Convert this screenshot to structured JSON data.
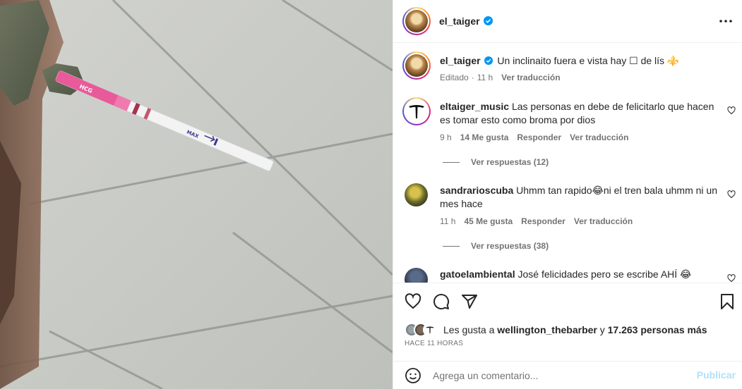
{
  "post": {
    "author": "el_taiger",
    "caption_user": "el_taiger",
    "caption_text": "Un inclinaito fuera e vista hay ☐ de lís ⚜️",
    "edited": "Editado",
    "dot": "·",
    "caption_time": "11 h",
    "translate": "Ver traducción"
  },
  "image": {
    "strip_text_1": "HCG",
    "strip_text_2": "MAX"
  },
  "comments": [
    {
      "user": "eltaiger_music",
      "text": "Las personas en debe de felicitarlo que hacen es tomar esto como broma por dios",
      "time": "9 h",
      "likes": "14 Me gusta",
      "reply": "Responder",
      "translate": "Ver traducción",
      "replies": "Ver respuestas (12)"
    },
    {
      "user": "sandrarioscuba",
      "text": "Uhmm tan rapido😂ni el tren bala uhmm ni un mes hace",
      "time": "11 h",
      "likes": "45 Me gusta",
      "reply": "Responder",
      "translate": "Ver traducción",
      "replies": "Ver respuestas (38)"
    },
    {
      "user": "gatoelambiental",
      "text": "José felicidades pero se escribe AHÍ 😂"
    }
  ],
  "likes": {
    "prefix": "Les gusta a",
    "user": "wellington_thebarber",
    "conj": "y",
    "others": "17.263 personas más"
  },
  "time_label": "HACE 11 HORAS",
  "comment_box": {
    "placeholder": "Agrega un comentario...",
    "publish": "Publicar"
  },
  "icons": {
    "more": "more-horizontal-icon",
    "like": "heart-icon",
    "comment": "comment-bubble-icon",
    "share": "send-icon",
    "save": "bookmark-icon",
    "emoji": "emoji-icon",
    "verified": "verified-badge-icon"
  },
  "colors": {
    "verified": "#0095f6",
    "muted": "#737373",
    "publish_disabled": "#b2dffc"
  }
}
